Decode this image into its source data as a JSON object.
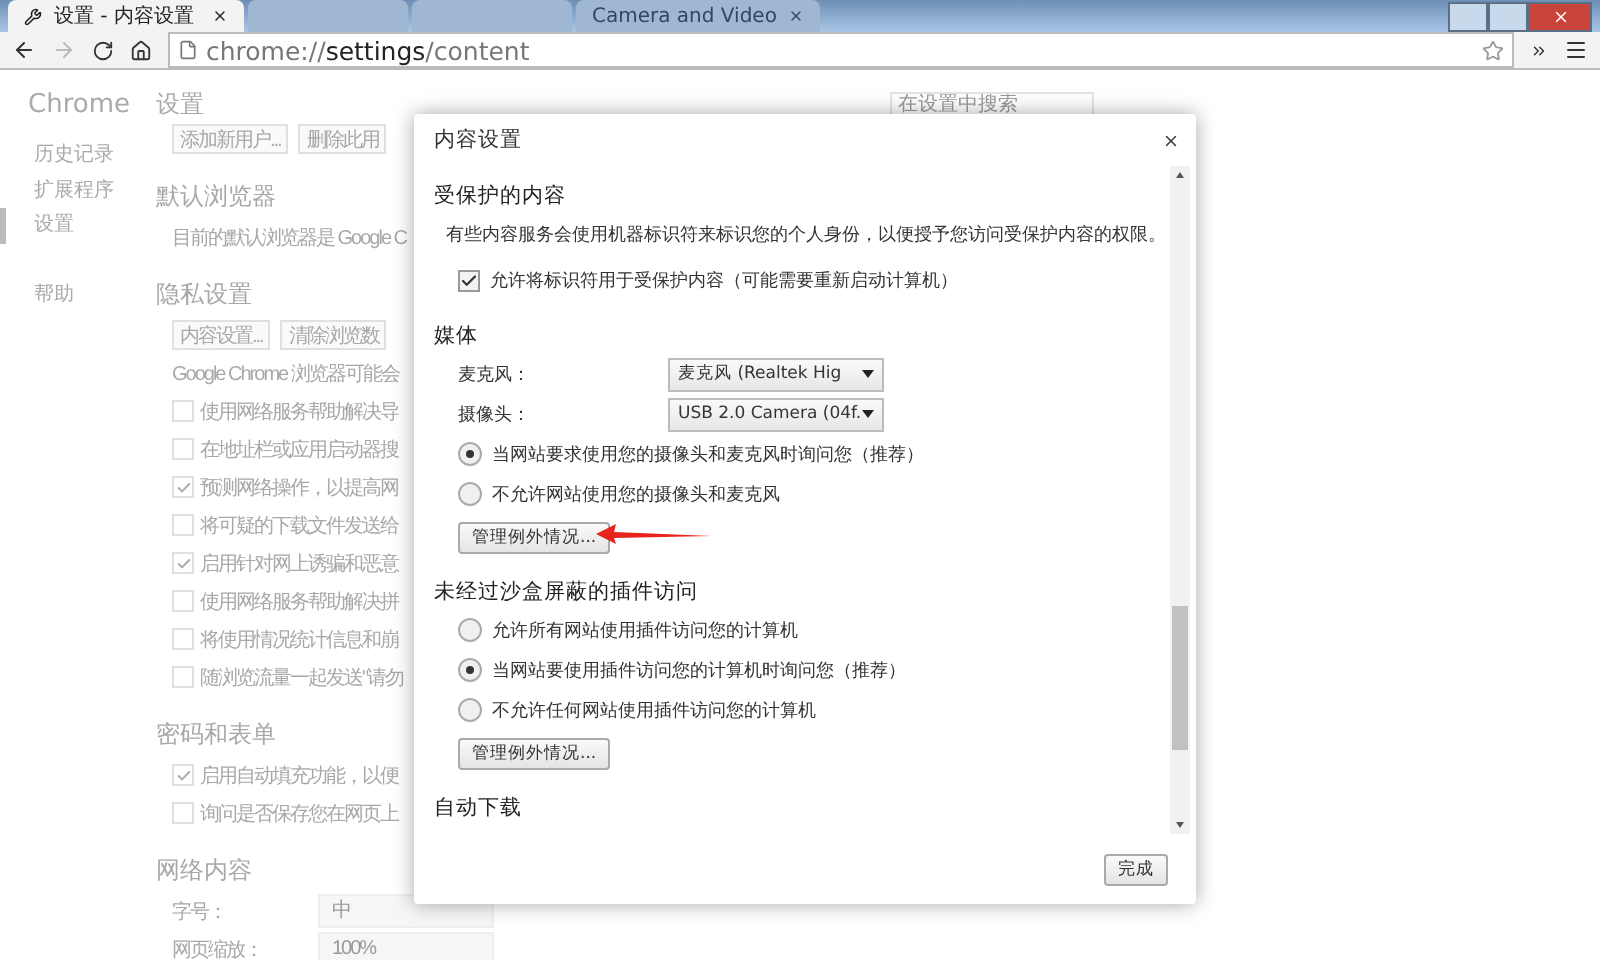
{
  "browser": {
    "tabs": [
      {
        "label": "设置 - 内容设置",
        "selected": true
      },
      {
        "label": "Camera and Video",
        "selected": false
      }
    ],
    "address": "chrome://**settings**/content"
  },
  "settings_page": {
    "sidebar": {
      "title": "Chrome",
      "items": [
        {
          "label": "历史记录",
          "selected": false
        },
        {
          "label": "扩展程序",
          "selected": false
        },
        {
          "label": "设置",
          "selected": true
        },
        {
          "label": "帮助",
          "selected": false
        }
      ]
    },
    "header": "设置",
    "search": {
      "placeholder": "在设置中搜索"
    },
    "rows": [
      {
        "kind": "buttons",
        "buttons": [
          "添加新用户...",
          "删除此用"
        ]
      },
      {
        "kind": "heading",
        "text": "默认浏览器"
      },
      {
        "kind": "text",
        "text": "目前的默认浏览器是 Google C"
      },
      {
        "kind": "heading",
        "text": "隐私设置"
      },
      {
        "kind": "buttons",
        "buttons": [
          "内容设置...",
          "清除浏览数"
        ]
      },
      {
        "kind": "text",
        "text": "Google Chrome 浏览器可能会"
      },
      {
        "kind": "checkbox",
        "label": "使用网络服务帮助解决导",
        "checked": false
      },
      {
        "kind": "checkbox",
        "label": "在地址栏或应用启动器搜",
        "checked": false
      },
      {
        "kind": "checkbox",
        "label": "预测网络操作，以提高网",
        "checked": true
      },
      {
        "kind": "checkbox",
        "label": "将可疑的下载文件发送给",
        "checked": false
      },
      {
        "kind": "checkbox",
        "label": "启用针对网上诱骗和恶意",
        "checked": true
      },
      {
        "kind": "checkbox",
        "label": "使用网络服务帮助解决拼",
        "checked": false
      },
      {
        "kind": "checkbox",
        "label": "将使用情况统计信息和崩",
        "checked": false
      },
      {
        "kind": "checkbox",
        "label": "随浏览流量一起发送\"请勿",
        "checked": false
      },
      {
        "kind": "heading",
        "text": "密码和表单"
      },
      {
        "kind": "checkbox",
        "label": "启用自动填充功能，以便",
        "checked": true
      },
      {
        "kind": "checkbox",
        "label": "询问是否保存您在网页上",
        "checked": false
      },
      {
        "kind": "heading",
        "text": "网络内容"
      },
      {
        "kind": "select",
        "label": "字号：",
        "value": "中"
      },
      {
        "kind": "select",
        "label": "网页缩放：",
        "value": "100%"
      }
    ]
  },
  "dialog": {
    "title": "内容设置",
    "sections": [
      {
        "heading": "受保护的内容",
        "items": [
          {
            "kind": "text",
            "text": "有些内容服务会使用机器标识符来标识您的个人身份，以便授予您访问受保护内容的权限。"
          },
          {
            "kind": "checkbox",
            "label": "允许将标识符用于受保护内容（可能需要重新启动计算机）",
            "checked": true
          }
        ]
      },
      {
        "heading": "媒体",
        "items": [
          {
            "kind": "select",
            "label": "麦克风：",
            "value": "麦克风 (Realtek Hig"
          },
          {
            "kind": "select",
            "label": "摄像头：",
            "value": "USB 2.0 Camera (04f."
          },
          {
            "kind": "radio",
            "label": "当网站要求使用您的摄像头和麦克风时询问您（推荐）",
            "selected": true
          },
          {
            "kind": "radio",
            "label": "不允许网站使用您的摄像头和麦克风",
            "selected": false
          },
          {
            "kind": "button",
            "label": "管理例外情况..."
          }
        ]
      },
      {
        "heading": "未经过沙盒屏蔽的插件访问",
        "items": [
          {
            "kind": "radio",
            "label": "允许所有网站使用插件访问您的计算机",
            "selected": false
          },
          {
            "kind": "radio",
            "label": "当网站要使用插件访问您的计算机时询问您（推荐）",
            "selected": true
          },
          {
            "kind": "radio",
            "label": "不允许任何网站使用插件访问您的计算机",
            "selected": false
          },
          {
            "kind": "button",
            "label": "管理例外情况..."
          }
        ]
      },
      {
        "heading": "自动下载"
      }
    ],
    "done_button": "完成"
  }
}
